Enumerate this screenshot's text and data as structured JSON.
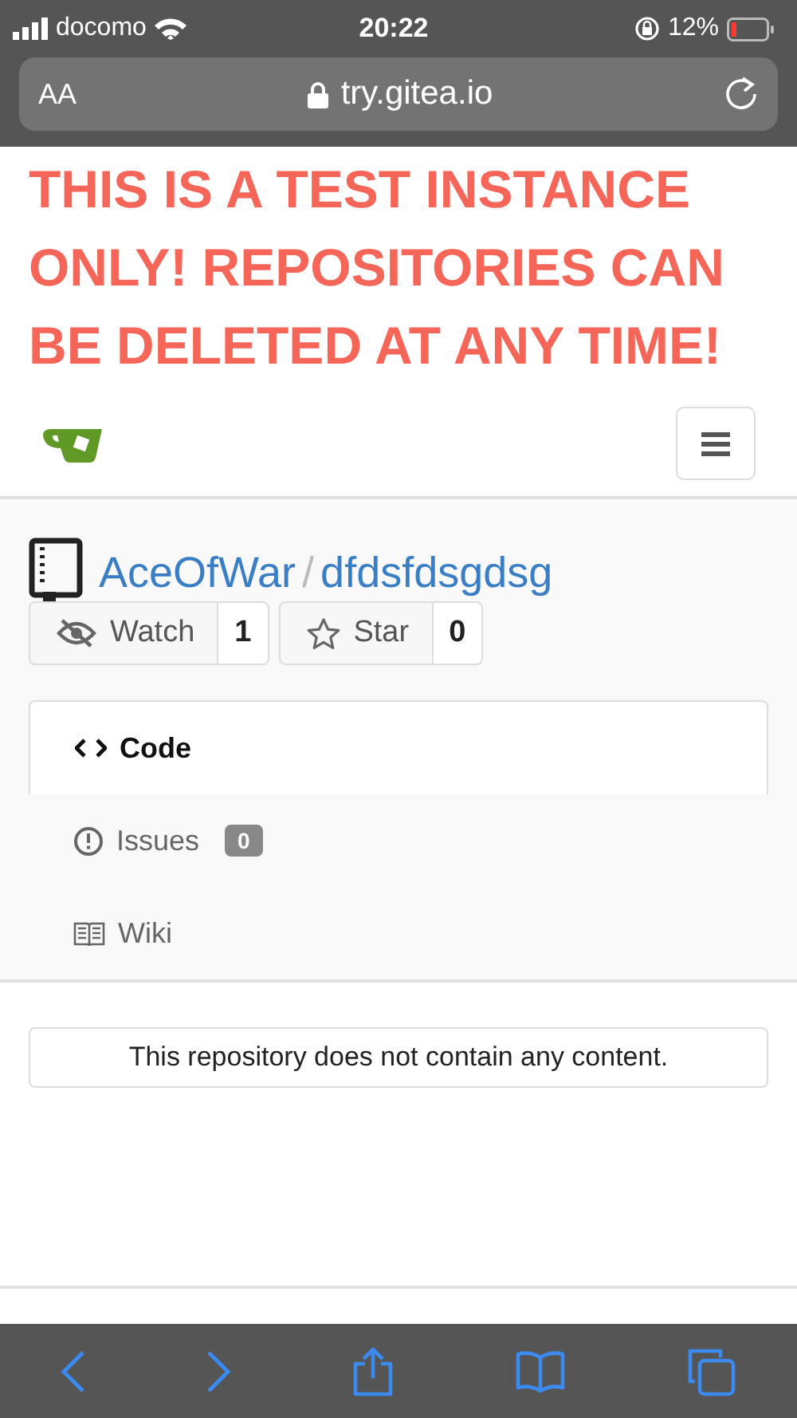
{
  "status_bar": {
    "carrier": "docomo",
    "time": "20:22",
    "battery": "12%"
  },
  "address_bar": {
    "text_size": "AA",
    "url": "try.gitea.io"
  },
  "banner": "THIS IS A TEST INSTANCE ONLY! REPOSITORIES CAN BE DELETED AT ANY TIME!",
  "repo": {
    "owner": "AceOfWar",
    "separator": "/",
    "name": "dfdsfdsgdsg"
  },
  "actions": [
    {
      "kind": "watch",
      "label": "Watch",
      "count": "1"
    },
    {
      "kind": "star",
      "label": "Star",
      "count": "0"
    }
  ],
  "menu": [
    {
      "kind": "code",
      "label": "Code",
      "selected": true
    },
    {
      "kind": "issues",
      "label": "Issues",
      "badge": "0",
      "selected": false
    },
    {
      "kind": "wiki",
      "label": "Wiki",
      "selected": false
    }
  ],
  "empty_message": "This repository does not contain any content."
}
